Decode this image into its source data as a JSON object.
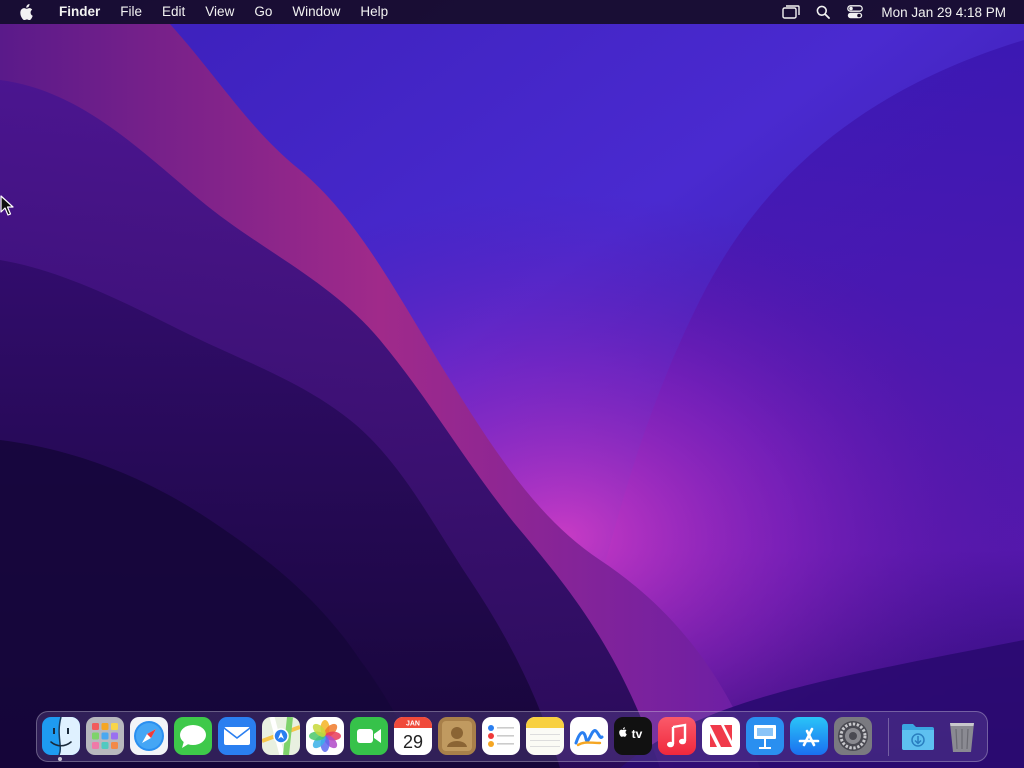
{
  "menubar": {
    "apple_icon": "apple-logo-icon",
    "app_name": "Finder",
    "menus": [
      "File",
      "Edit",
      "View",
      "Go",
      "Window",
      "Help"
    ],
    "status_icons": [
      "screen-mirroring-icon",
      "spotlight-search-icon",
      "control-center-icon"
    ],
    "clock": "Mon Jan 29  4:18 PM"
  },
  "calendar_icon": {
    "month": "JAN",
    "day": "29"
  },
  "appletv_icon": {
    "label": "tv"
  },
  "dock": {
    "apps": [
      {
        "name": "Finder",
        "icon": "finder-icon",
        "running": true
      },
      {
        "name": "Launchpad",
        "icon": "launchpad-icon"
      },
      {
        "name": "Safari",
        "icon": "safari-icon"
      },
      {
        "name": "Messages",
        "icon": "messages-icon"
      },
      {
        "name": "Mail",
        "icon": "mail-icon"
      },
      {
        "name": "Maps",
        "icon": "maps-icon"
      },
      {
        "name": "Photos",
        "icon": "photos-icon"
      },
      {
        "name": "FaceTime",
        "icon": "facetime-icon"
      },
      {
        "name": "Calendar",
        "icon": "calendar-icon"
      },
      {
        "name": "Contacts",
        "icon": "contacts-icon"
      },
      {
        "name": "Reminders",
        "icon": "reminders-icon"
      },
      {
        "name": "Notes",
        "icon": "notes-icon"
      },
      {
        "name": "Freeform",
        "icon": "freeform-icon"
      },
      {
        "name": "TV",
        "icon": "apple-tv-icon"
      },
      {
        "name": "Music",
        "icon": "music-icon"
      },
      {
        "name": "News",
        "icon": "news-icon"
      },
      {
        "name": "Keynote",
        "icon": "keynote-icon"
      },
      {
        "name": "App Store",
        "icon": "app-store-icon"
      },
      {
        "name": "System Settings",
        "icon": "system-settings-icon"
      }
    ],
    "extras": [
      {
        "name": "Downloads",
        "icon": "downloads-folder-icon"
      },
      {
        "name": "Trash",
        "icon": "trash-icon"
      }
    ]
  },
  "colors": {
    "wallpaper_dark": "#1e0a55",
    "wallpaper_purple": "#6a1fb0",
    "wallpaper_glow": "#c03cc0",
    "menubar_bg": "#160c28"
  }
}
